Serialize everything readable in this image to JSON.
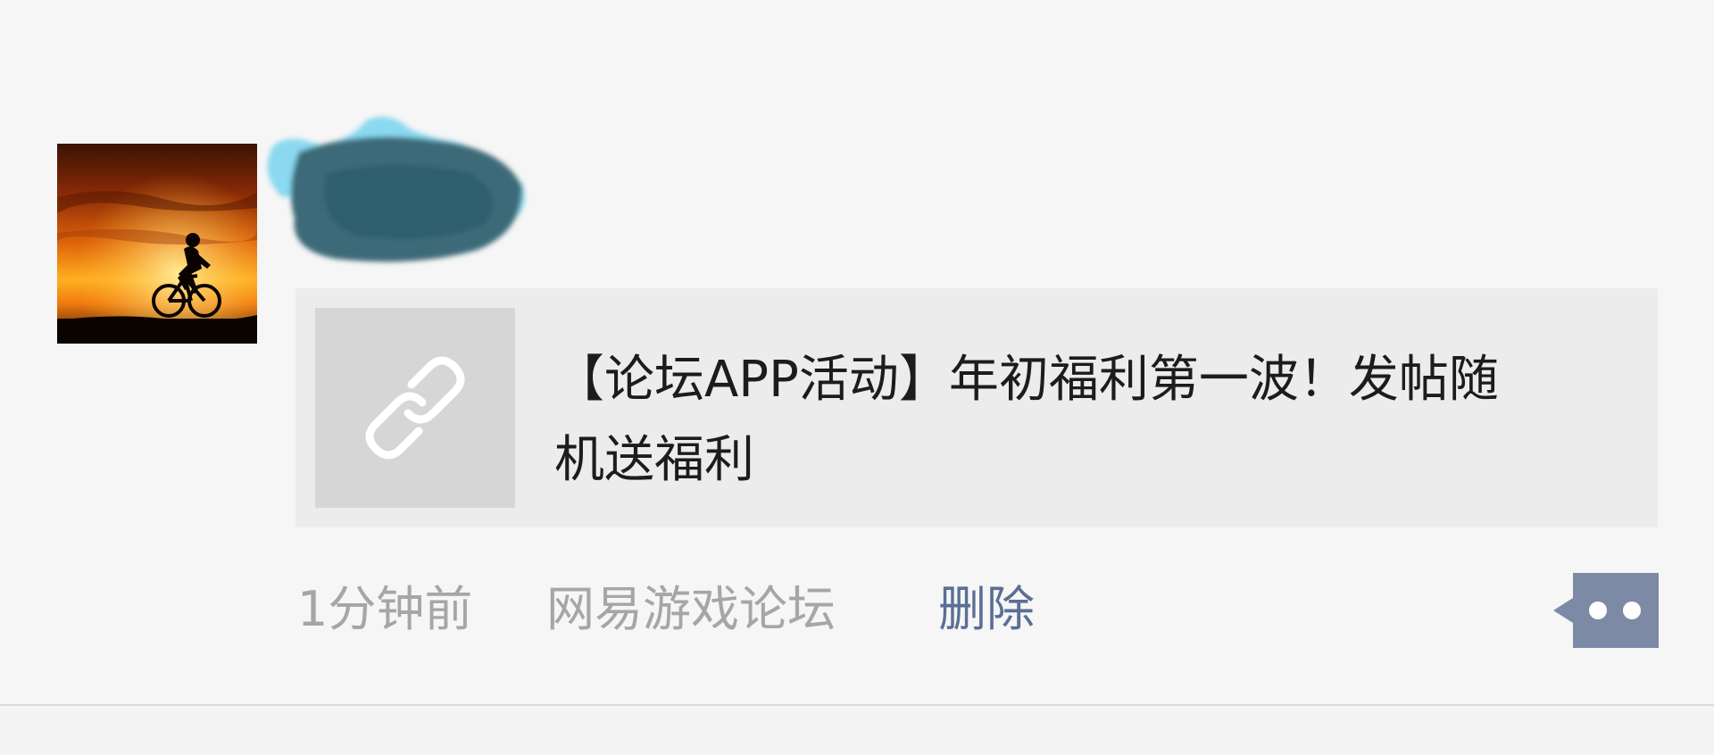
{
  "post": {
    "avatar_icon": "avatar-cyclist-sunset",
    "username_redacted": true,
    "shared_link": {
      "icon": "link-chain-icon",
      "title": "【论坛APP活动】年初福利第一波！发帖随机送福利"
    },
    "meta": {
      "time": "1分钟前",
      "source": "网易游戏论坛",
      "delete_label": "删除"
    },
    "comment_button_icon": "comment-dots-icon"
  },
  "colors": {
    "background": "#f6f6f6",
    "card": "#ececec",
    "thumb": "#d6d6d6",
    "meta_gray": "#a6a6a6",
    "link_blue": "#5b6f95",
    "comment_button": "#7d8aa5"
  }
}
